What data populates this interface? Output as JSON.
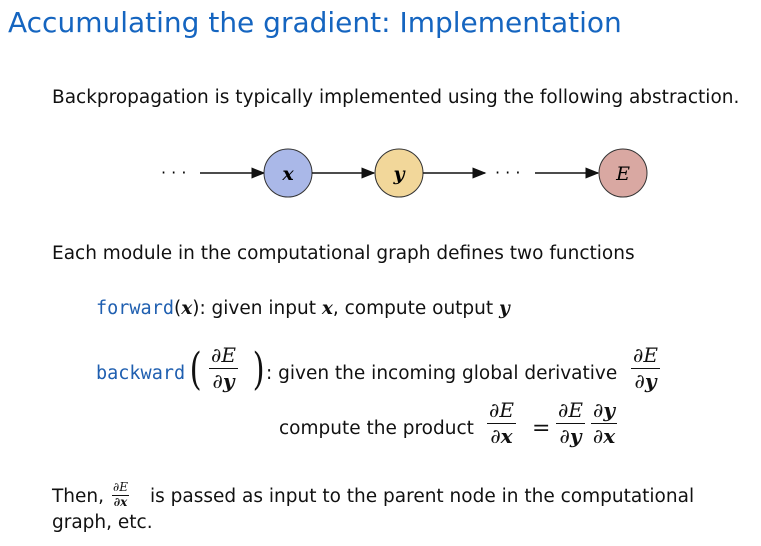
{
  "title": "Accumulating the gradient: Implementation",
  "intro": "Backpropagation is typically implemented using the following abstraction.",
  "graph": {
    "ellipsis": "· · ·",
    "nodes": [
      {
        "label": "x",
        "color": "#aab8e8"
      },
      {
        "label": "y",
        "color": "#f2d79a"
      },
      {
        "label": "E",
        "color": "#d9a8a2"
      }
    ]
  },
  "module_intro": "Each module in the computational graph defines two functions",
  "forward": {
    "fn": "forward",
    "arg": "x",
    "text_1": ": given input ",
    "input": "x",
    "text_2": ", compute output ",
    "output": "y"
  },
  "backward": {
    "fn": "backward",
    "frac_num": "∂E",
    "frac_den": "∂y",
    "text": ": given the incoming global derivative",
    "global_num": "∂E",
    "global_den": "∂y",
    "product_text": "compute the product",
    "lhs_num": "∂E",
    "lhs_den": "∂x",
    "equals": "=",
    "rhs1_num": "∂E",
    "rhs1_den": "∂y",
    "rhs2_num": "∂y",
    "rhs2_den": "∂x"
  },
  "conclusion": {
    "prefix": "Then,",
    "frac_num": "∂E",
    "frac_den": "∂x",
    "line1": "is passed as input to the parent node in the computational",
    "line2": "graph, etc."
  }
}
